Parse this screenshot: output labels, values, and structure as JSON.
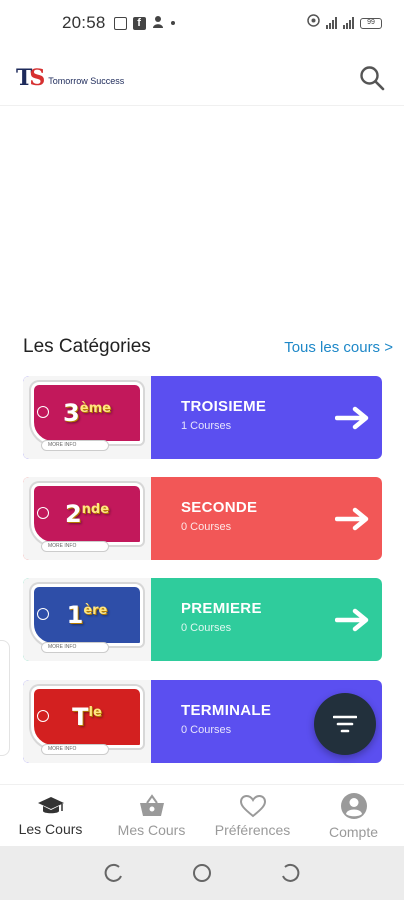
{
  "status_bar": {
    "time": "20:58",
    "battery": "99"
  },
  "header": {
    "logo_mark_t": "T",
    "logo_mark_s": "S",
    "logo_text": "Tomorrow Success"
  },
  "section": {
    "title": "Les Catégories",
    "see_all": "Tous les cours >"
  },
  "categories": [
    {
      "title": "TROISIEME",
      "courses": "1 Courses",
      "level": "3",
      "level_sup": "ème",
      "color": "#5b4ff0",
      "thumb_color": "#c2185b"
    },
    {
      "title": "SECONDE",
      "courses": "0 Courses",
      "level": "2",
      "level_sup": "nde",
      "color": "#f25757",
      "thumb_color": "#c2185b"
    },
    {
      "title": "PREMIERE",
      "courses": "0 Courses",
      "level": "1",
      "level_sup": "ère",
      "color": "#2fcc9c",
      "thumb_color": "#2e4ea8"
    },
    {
      "title": "TERMINALE",
      "courses": "0 Courses",
      "level": "T",
      "level_sup": "le",
      "color": "#5b4ff0",
      "thumb_color": "#d32020"
    }
  ],
  "thumb_info_text": "MORE INFO",
  "bottom_nav": [
    {
      "label": "Les Cours",
      "icon": "graduation-cap-icon"
    },
    {
      "label": "Mes Cours",
      "icon": "basket-icon"
    },
    {
      "label": "Préférences",
      "icon": "heart-icon"
    },
    {
      "label": "Compte",
      "icon": "account-icon"
    }
  ],
  "colors": {
    "link": "#1e88c8",
    "fab": "#22303c"
  }
}
